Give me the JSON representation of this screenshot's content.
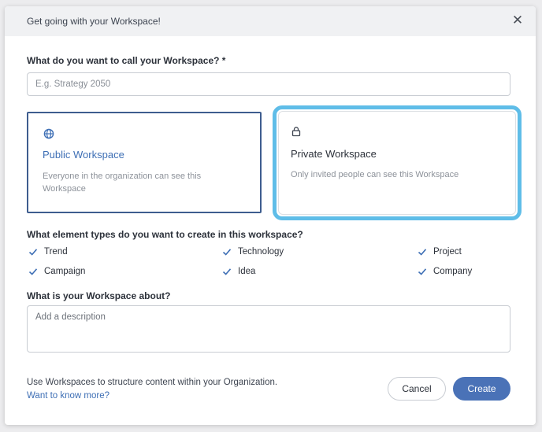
{
  "dialog": {
    "title": "Get going with your Workspace!",
    "close_icon": "close-icon"
  },
  "name_field": {
    "label": "What do you want to call your Workspace? *",
    "value": "",
    "placeholder": "E.g. Strategy 2050"
  },
  "visibility": {
    "public": {
      "icon": "globe-icon",
      "title": "Public Workspace",
      "description": "Everyone in the organization can see this Workspace",
      "selected": true
    },
    "private": {
      "icon": "lock-icon",
      "title": "Private Workspace",
      "description": "Only invited people can see this Workspace",
      "selected": false
    }
  },
  "element_types": {
    "label": "What element types do you want to create in this workspace?",
    "items": [
      {
        "label": "Trend",
        "checked": true
      },
      {
        "label": "Technology",
        "checked": true
      },
      {
        "label": "Project",
        "checked": true
      },
      {
        "label": "Campaign",
        "checked": true
      },
      {
        "label": "Idea",
        "checked": true
      },
      {
        "label": "Company",
        "checked": true
      }
    ]
  },
  "about": {
    "label": "What is your Workspace about?",
    "value": "",
    "placeholder": "Add a description"
  },
  "footer": {
    "info_text": "Use Workspaces to structure content within your Organization.",
    "link_text": "Want to know more?",
    "cancel_label": "Cancel",
    "create_label": "Create"
  },
  "colors": {
    "primary": "#4a72b7",
    "public_accent": "#3e6fb5",
    "selection_highlight": "#5fbde8",
    "check": "#3e6fb5"
  }
}
